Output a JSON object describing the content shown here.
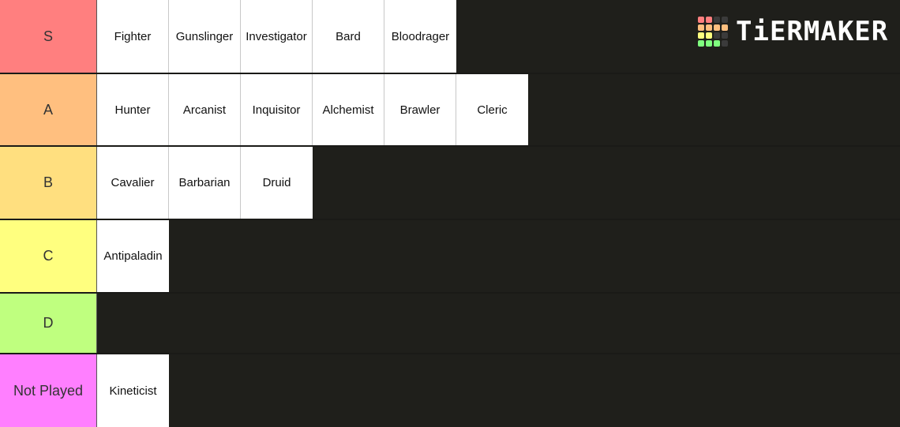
{
  "brand": {
    "name": "TiERMAKER",
    "grid_colors": [
      "#ff7f7f",
      "#ff7f7f",
      "#3b3b3b",
      "#3b3b3b",
      "#ffbf7f",
      "#ffbf7f",
      "#ffbf7f",
      "#ffbf7f",
      "#ffff7f",
      "#ffff7f",
      "#3b3b3b",
      "#3b3b3b",
      "#7fff7f",
      "#7fff7f",
      "#7fff7f",
      "#3b3b3b"
    ]
  },
  "tiers": [
    {
      "label": "S",
      "color": "#ff7f7f",
      "items": [
        "Fighter",
        "Gunslinger",
        "Investigator",
        "Bard",
        "Bloodrager"
      ]
    },
    {
      "label": "A",
      "color": "#ffbf7f",
      "items": [
        "Hunter",
        "Arcanist",
        "Inquisitor",
        "Alchemist",
        "Brawler",
        "Cleric"
      ]
    },
    {
      "label": "B",
      "color": "#ffdf7f",
      "items": [
        "Cavalier",
        "Barbarian",
        "Druid"
      ]
    },
    {
      "label": "C",
      "color": "#ffff7f",
      "items": [
        "Antipaladin"
      ]
    },
    {
      "label": "D",
      "color": "#bfff7f",
      "items": []
    },
    {
      "label": "Not Played",
      "color": "#ff7fff",
      "items": [
        "Kineticist"
      ]
    }
  ]
}
